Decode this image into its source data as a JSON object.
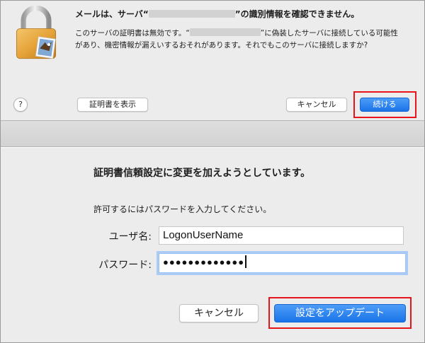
{
  "top_dialog": {
    "title_prefix": "メールは、サーバ“",
    "title_suffix": "”の識別情報を確認できません。",
    "body_line1_prefix": "このサーバの証明書は無効です。“",
    "body_line1_suffix": "”に偽装したサーバに接続している可能性",
    "body_line2": "があり、機密情報が漏えいするおそれがあります。それでもこのサーバに接続しますか?",
    "help_label": "?",
    "show_cert_label": "証明書を表示",
    "cancel_label": "キャンセル",
    "continue_label": "続ける"
  },
  "bottom_dialog": {
    "title": "証明書信頼設定に変更を加えようとしています。",
    "body": "許可するにはパスワードを入力してください。",
    "username_label": "ユーザ名:",
    "username_value": "LogonUserName",
    "password_label": "パスワード:",
    "password_value": "●●●●●●●●●●●●●",
    "cancel_label": "キャンセル",
    "update_label": "設定をアップデート"
  },
  "colors": {
    "dialog_bg": "#ececec",
    "accent_blue": "#1a73e8",
    "highlight_red": "#e8141c",
    "lock_gold": "#e5a33a"
  },
  "icons": {
    "lock": "padlock-with-eagle-stamp-icon",
    "help": "question-mark-icon"
  }
}
